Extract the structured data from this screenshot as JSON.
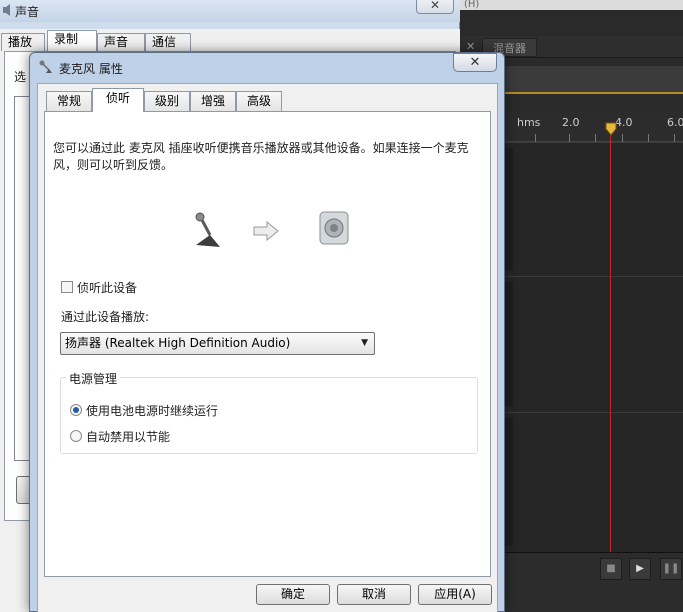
{
  "background_app": {
    "topbar_text": "(H)",
    "tab_label": "混音器",
    "ruler": {
      "unit": "hms",
      "marks": [
        "2.0",
        "4.0",
        "6.0"
      ]
    },
    "accent_color": "#b88a28",
    "playhead_color": "#c0282b"
  },
  "sound_dialog": {
    "title": "声音",
    "close_label": "✕",
    "tabs": [
      "播放",
      "录制",
      "声音",
      "通信"
    ],
    "active_tab": "录制",
    "prompt": "选"
  },
  "mic_dialog": {
    "title": "麦克风 属性",
    "close_label": "✕",
    "tabs": [
      "常规",
      "侦听",
      "级别",
      "增强",
      "高级"
    ],
    "active_tab": "侦听",
    "description": "您可以通过此 麦克风 插座收听便携音乐播放器或其他设备。如果连接一个麦克风，则可以听到反馈。",
    "icons": [
      "microphone-icon",
      "arrow-right-icon",
      "speaker-icon"
    ],
    "listen_checkbox": {
      "label": "侦听此设备",
      "checked": false
    },
    "playback_label": "通过此设备播放:",
    "playback_device": "扬声器 (Realtek High Definition Audio)",
    "power": {
      "legend": "电源管理",
      "options": [
        {
          "label": "使用电池电源时继续运行",
          "checked": true
        },
        {
          "label": "自动禁用以节能",
          "checked": false
        }
      ]
    },
    "buttons": {
      "ok": "确定",
      "cancel": "取消",
      "apply": "应用(A)"
    }
  }
}
